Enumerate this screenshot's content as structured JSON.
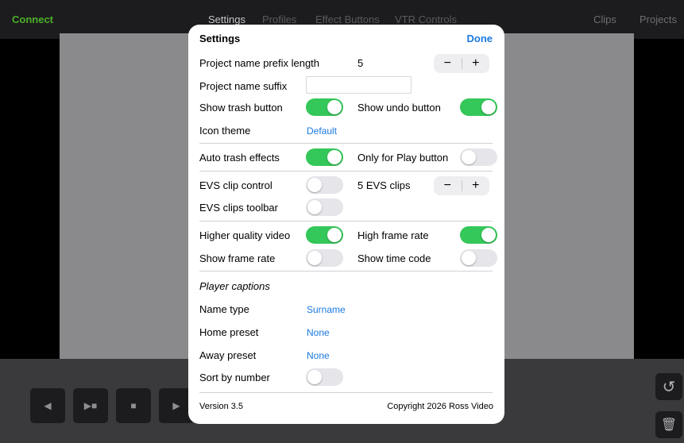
{
  "topbar": {
    "connect": "Connect",
    "settings": "Settings",
    "profiles": "Profiles",
    "effect_buttons": "Effect Buttons",
    "vtr_controls": "VTR Controls",
    "clips": "Clips",
    "projects": "Projects"
  },
  "transport": {
    "prev": "◀",
    "play_pause": "▶■",
    "stop": "■",
    "next": "▶"
  },
  "side": {
    "undo": "↺",
    "trash": "🗑"
  },
  "modal": {
    "title": "Settings",
    "done": "Done",
    "prefix_length_label": "Project name prefix length",
    "prefix_length_value": "5",
    "suffix_label": "Project name suffix",
    "suffix_value": "",
    "show_trash_label": "Show trash button",
    "show_trash": true,
    "show_undo_label": "Show undo button",
    "show_undo": true,
    "icon_theme_label": "Icon theme",
    "icon_theme_value": "Default",
    "auto_trash_label": "Auto trash effects",
    "auto_trash": true,
    "only_play_label": "Only for Play button",
    "only_play": false,
    "evs_clip_control_label": "EVS clip control",
    "evs_clip_control": false,
    "evs_clips_label": "5 EVS clips",
    "evs_toolbar_label": "EVS clips toolbar",
    "evs_toolbar": false,
    "hq_video_label": "Higher quality video",
    "hq_video": true,
    "high_fps_label": "High frame rate",
    "high_fps": true,
    "show_fps_label": "Show frame rate",
    "show_fps": false,
    "show_timecode_label": "Show time code",
    "show_timecode": false,
    "player_captions": "Player captions",
    "name_type_label": "Name type",
    "name_type_value": "Surname",
    "home_preset_label": "Home preset",
    "home_preset_value": "None",
    "away_preset_label": "Away preset",
    "away_preset_value": "None",
    "sort_number_label": "Sort by number",
    "sort_number": false,
    "version": "Version 3.5",
    "copyright": "Copyright 2026 Ross Video",
    "minus": "−",
    "plus": "+"
  }
}
